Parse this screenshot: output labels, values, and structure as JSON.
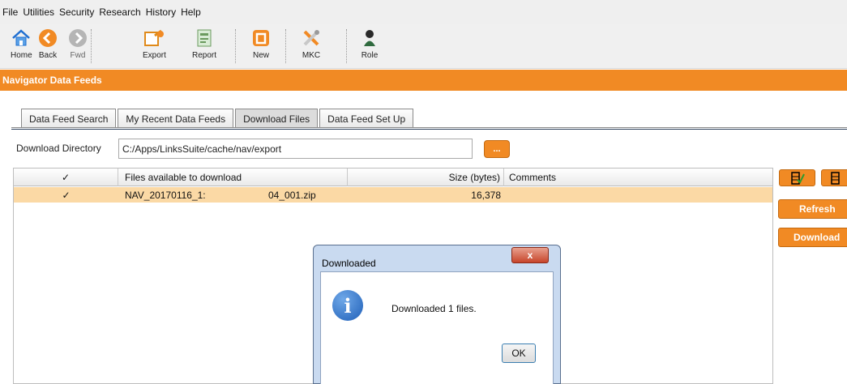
{
  "menu": [
    "File",
    "Utilities",
    "Security",
    "Research",
    "History",
    "Help"
  ],
  "toolbar": {
    "home": "Home",
    "back": "Back",
    "fwd": "Fwd",
    "export": "Export",
    "report": "Report",
    "new": "New",
    "mkc": "MKC",
    "role": "Role"
  },
  "panel_title": "Navigator Data Feeds",
  "tabs": [
    "Data Feed Search",
    "My Recent Data Feeds",
    "Download Files",
    "Data Feed Set Up"
  ],
  "active_tab": "Download Files",
  "download_dir": {
    "label": "Download Directory",
    "value": "C:/Apps/LinksSuite/cache/nav/export",
    "browse_label": "..."
  },
  "table": {
    "columns": [
      "✓",
      "Files available to download",
      "Size (bytes)",
      "Comments"
    ],
    "rows": [
      {
        "check": "✓",
        "file": "NAV_20170116_1:",
        "file_suffix": "04_001.zip",
        "size": "16,378",
        "comments": ""
      }
    ]
  },
  "side_buttons": {
    "refresh": "Refresh",
    "download": "Download"
  },
  "dialog": {
    "title": "Downloaded",
    "close": "x",
    "message": "Downloaded 1 files.",
    "ok": "OK"
  },
  "colors": {
    "accent": "#f18a24",
    "selected_row": "#fbd9a5"
  }
}
